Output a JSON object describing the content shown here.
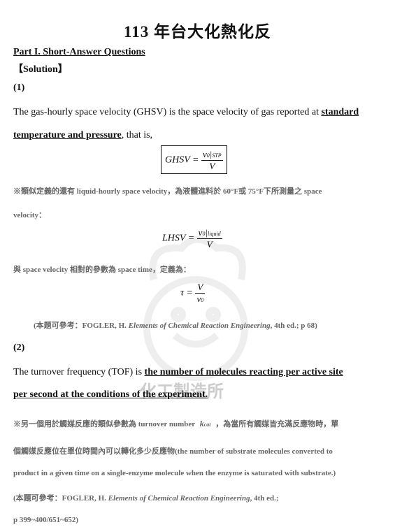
{
  "title": "113 年台大化熱化反",
  "part_heading": "Part I. Short-Answer Questions",
  "solution_heading": "【Solution】",
  "q1": {
    "label": "(1)",
    "text_intro": "The gas-hourly space velocity (GHSV) is the space velocity of gas reported at ",
    "text_bold_a": "standard",
    "text_bold_b": "temperature and pressure",
    "text_tail": ", that is,",
    "eq_ghsv": {
      "lhs": "GHSV =",
      "num": "v",
      "num_sub0": "0",
      "num_sub": "STP",
      "den": "V"
    },
    "note1_line1": "※類似定義的還有 liquid-hourly space velocity，為液體進料於 60°F或 75°F下所測量之 space",
    "note1_line2": "velocity：",
    "eq_lhsv": {
      "lhs": "LHSV =",
      "num": "v",
      "num_sub0": "0",
      "num_sub": "liquid",
      "den": "V"
    },
    "note2": "與 space velocity 相對的參數為 space time，定義為：",
    "eq_tau": {
      "lhs": "τ =",
      "num": "V",
      "den": "v",
      "den_sub": "0"
    },
    "ref_prefix": "(本題可參考：FOGLER, H. ",
    "ref_book": "Elements of Chemical Reaction Engineering",
    "ref_suffix": ", 4th ed.; p 68)"
  },
  "q2": {
    "label": "(2)",
    "text_intro": "The turnover frequency (TOF) is ",
    "text_bold_a": "the number of molecules reacting per active site",
    "text_bold_b": "per second at the conditions of the experiment.",
    "note_part1": "※另一個用於觸媒反應的類似參數為 turnover number",
    "note_symbol": "k",
    "note_symbol_sub": "cat",
    "note_part2": "，為當所有觸媒皆充滿反應物時，單",
    "note_line2": "個觸媒反應位在單位時間內可以轉化多少反應物(the number of substrate molecules converted to",
    "note_line3": "product in a given time on a single-enzyme molecule when the enzyme is saturated with substrate.)",
    "ref_prefix": "(本題可參考：FOGLER, H. ",
    "ref_book": "Elements of Chemical Reaction Engineering",
    "ref_suffix": ", 4th ed.;",
    "ref_pages": "p 399~400/651~652)"
  },
  "watermark": "化工製造所"
}
